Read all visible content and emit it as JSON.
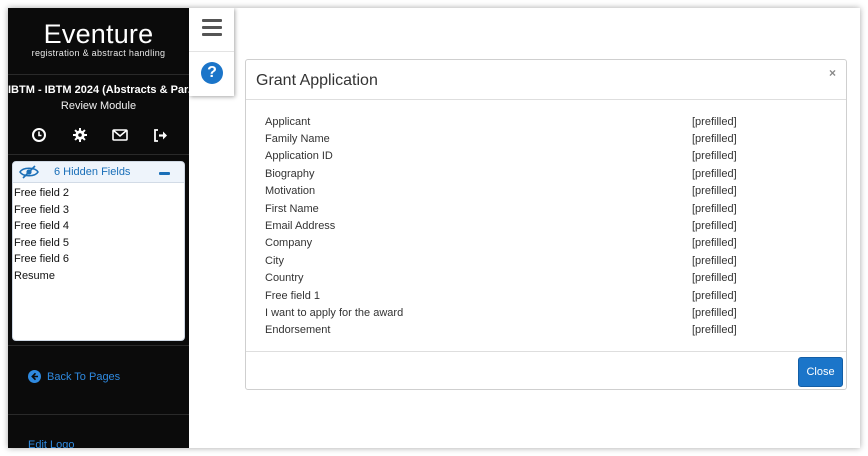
{
  "sidebar": {
    "logo_main": "Eventure",
    "logo_sub": "registration & abstract handling",
    "event_title": "IBTM - IBTM 2024 (Abstracts & Par...",
    "module_name": "Review Module",
    "icons": [
      "clock-icon",
      "gear-icon",
      "envelope-icon",
      "sign-out-icon"
    ],
    "hidden_fields": {
      "title": "6 Hidden Fields",
      "items": [
        "Free field 2",
        "Free field 3",
        "Free field 4",
        "Free field 5",
        "Free field 6",
        "Resume"
      ]
    },
    "back_link": "Back To Pages",
    "edit_logo": "Edit Logo"
  },
  "modal": {
    "title": "Grant Application",
    "close_x": "×",
    "close_label": "Close",
    "fields": [
      {
        "name": "Applicant",
        "value": "[prefilled]"
      },
      {
        "name": "Family Name",
        "value": "[prefilled]"
      },
      {
        "name": "Application ID",
        "value": "[prefilled]"
      },
      {
        "name": "Biography",
        "value": "[prefilled]"
      },
      {
        "name": "Motivation",
        "value": "[prefilled]"
      },
      {
        "name": "First Name",
        "value": "[prefilled]"
      },
      {
        "name": "Email Address",
        "value": "[prefilled]"
      },
      {
        "name": "Company",
        "value": "[prefilled]"
      },
      {
        "name": "City",
        "value": "[prefilled]"
      },
      {
        "name": "Country",
        "value": "[prefilled]"
      },
      {
        "name": "Free field 1",
        "value": "[prefilled]"
      },
      {
        "name": "I want to apply for the award",
        "value": "[prefilled]"
      },
      {
        "name": "Endorsement",
        "value": "[prefilled]"
      }
    ]
  },
  "nav": {
    "help_glyph": "?"
  },
  "colors": {
    "sidebar_bg": "#0b0b0b",
    "accent_blue": "#1b75c9",
    "link_blue": "#2f8ae0"
  }
}
